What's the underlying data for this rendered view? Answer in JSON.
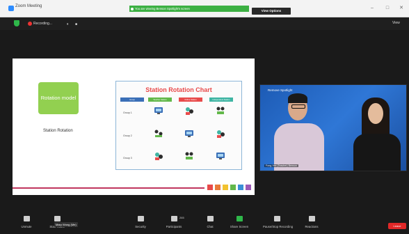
{
  "window": {
    "title": "Zoom Meeting",
    "share_banner": "You are viewing Benson Spotlight's screen",
    "view_options": "View Options",
    "minimize": "–",
    "maximize": "□",
    "close": "✕"
  },
  "meeting_bar": {
    "recording_label": "Recording...",
    "pause": "⏸",
    "stop": "■",
    "view_label": "View"
  },
  "slide": {
    "box_label": "Rotation model",
    "subtitle": "Station Rotation",
    "chart_title": "Station Rotation Chart",
    "columns": [
      "Group",
      "Teacher Station",
      "Online Station",
      "Independent Station"
    ],
    "rows": [
      "Group 1",
      "Group 2",
      "Group 3"
    ],
    "swatches": [
      "#e84a4a",
      "#e97a3a",
      "#f2c230",
      "#62b84a",
      "#3a8fd6",
      "#9b59b6"
    ]
  },
  "video": {
    "spotlight_label": "Remove Spotlight",
    "participant_name": "Fong-Yee (Teacher) Benson"
  },
  "toolbar": {
    "items": [
      {
        "label": "Unmute"
      },
      {
        "label": "Start Video"
      },
      {
        "label": "Security"
      },
      {
        "label": "Participants",
        "count": "265"
      },
      {
        "label": "Chat"
      },
      {
        "label": "Share Screen"
      },
      {
        "label": "Pause/Stop Recording"
      },
      {
        "label": "Reactions"
      }
    ],
    "tooltip": "Mary Wong (Me)",
    "leave": "Leave"
  }
}
